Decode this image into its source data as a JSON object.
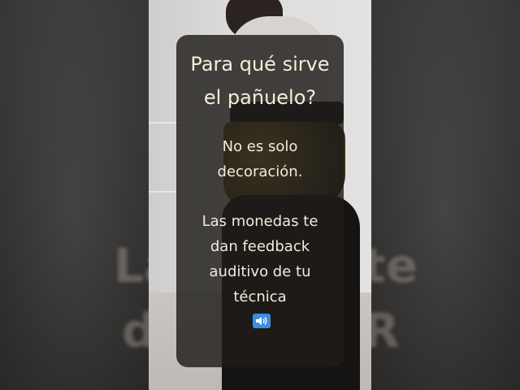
{
  "overlay": {
    "heading_lines": [
      "Para qué sirve",
      "el pañuelo?"
    ],
    "paragraph1_lines": [
      "No es solo",
      "decoración."
    ],
    "paragraph2_lines": [
      "Las monedas te",
      "dan feedback",
      "auditivo de tu",
      "técnica"
    ],
    "trailing_icon": "speaker-loud-icon"
  },
  "background": {
    "ghost_fragments": [
      "La",
      "te",
      "d",
      "R"
    ]
  },
  "colors": {
    "card_background": "#1e1c1a",
    "text": "#f1ecd9",
    "icon_blue": "#3a8fe0"
  }
}
